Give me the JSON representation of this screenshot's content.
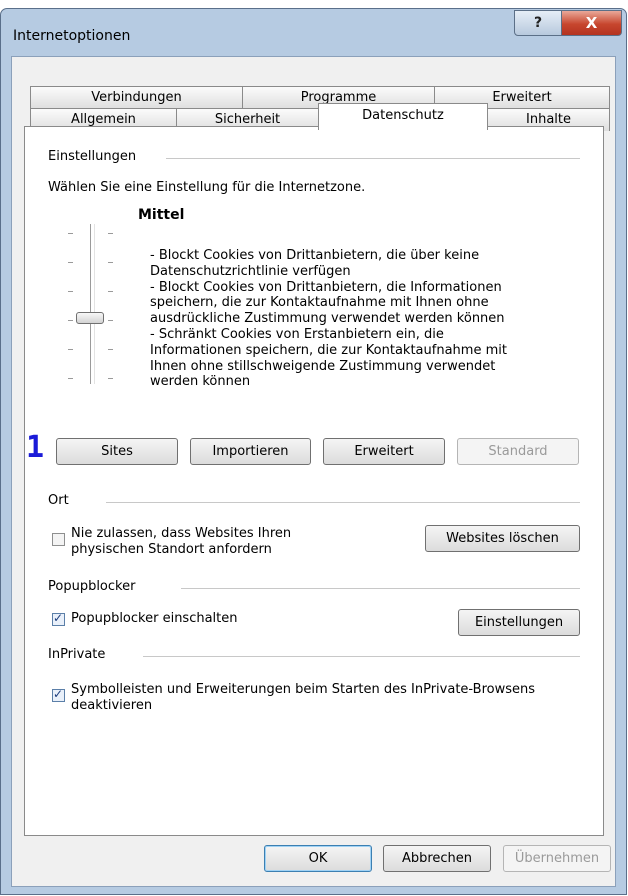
{
  "window": {
    "title": "Internetoptionen",
    "help_label": "?",
    "close_label": "X"
  },
  "tabs_top": [
    "Verbindungen",
    "Programme",
    "Erweitert"
  ],
  "tabs_bottom": [
    "Allgemein",
    "Sicherheit",
    "Datenschutz",
    "Inhalte"
  ],
  "active_tab": "Datenschutz",
  "settings": {
    "section": "Einstellungen",
    "instruction": "Wählen Sie eine Einstellung für die Internetzone.",
    "level": "Mittel",
    "description": [
      "- Blockt Cookies von Drittanbietern, die über keine",
      "Datenschutzrichtlinie verfügen",
      "- Blockt Cookies von Drittanbietern, die Informationen",
      "speichern, die zur Kontaktaufnahme mit Ihnen ohne",
      "ausdrückliche Zustimmung verwendet werden können",
      "- Schränkt Cookies von Erstanbietern ein, die",
      "Informationen speichern, die zur Kontaktaufnahme mit",
      "Ihnen ohne stillschweigende Zustimmung verwendet",
      "werden können"
    ],
    "buttons": {
      "sites": "Sites",
      "import": "Importieren",
      "advanced": "Erweitert",
      "default": "Standard"
    }
  },
  "annotation": "1",
  "location": {
    "section": "Ort",
    "checkbox_line1": "Nie zulassen, dass Websites Ihren",
    "checkbox_line2": "physischen Standort anfordern",
    "clear_button": "Websites löschen"
  },
  "popup": {
    "section": "Popupblocker",
    "checkbox": "Popupblocker einschalten",
    "settings_button": "Einstellungen"
  },
  "inprivate": {
    "section": "InPrivate",
    "checkbox_line1": "Symbolleisten und Erweiterungen beim Starten des InPrivate-Browsens",
    "checkbox_line2": "deaktivieren"
  },
  "footer": {
    "ok": "OK",
    "cancel": "Abbrechen",
    "apply": "Übernehmen"
  }
}
